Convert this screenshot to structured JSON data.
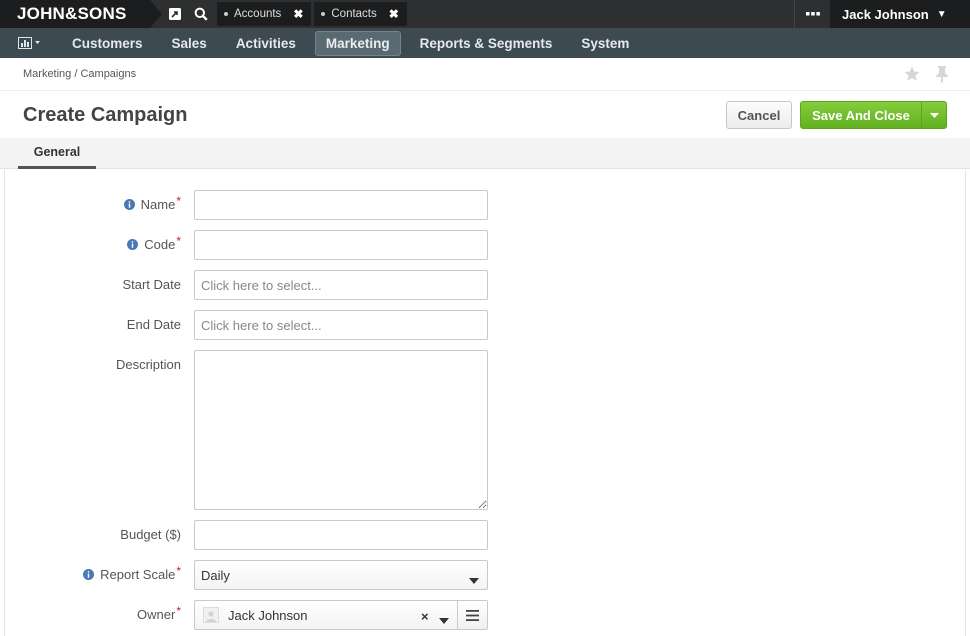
{
  "topbar": {
    "logo": "JOHN&SONS",
    "icons": [
      "external-link-icon",
      "search-icon"
    ],
    "pinned_tabs": [
      {
        "label": "Accounts"
      },
      {
        "label": "Contacts"
      }
    ],
    "more_icon": "ellipsis-icon",
    "user_name": "Jack Johnson"
  },
  "nav": {
    "dashboard_icon": "bar-chart-icon",
    "items": [
      "Customers",
      "Sales",
      "Activities",
      "Marketing",
      "Reports & Segments",
      "System"
    ],
    "active": "Marketing"
  },
  "breadcrumb": "Marketing / Campaigns",
  "page": {
    "title": "Create Campaign",
    "cancel_label": "Cancel",
    "save_label": "Save And Close"
  },
  "tabs": [
    {
      "label": "General"
    }
  ],
  "form": {
    "name": {
      "label": "Name",
      "value": ""
    },
    "code": {
      "label": "Code",
      "value": ""
    },
    "start_date": {
      "label": "Start Date",
      "placeholder": "Click here to select..."
    },
    "end_date": {
      "label": "End Date",
      "placeholder": "Click here to select..."
    },
    "description": {
      "label": "Description",
      "value": ""
    },
    "budget": {
      "label": "Budget ($)",
      "value": ""
    },
    "report_scale": {
      "label": "Report Scale",
      "value": "Daily"
    },
    "owner": {
      "label": "Owner",
      "value": "Jack Johnson"
    }
  },
  "colors": {
    "topbar": "#2e2f30",
    "navbar": "#3d4a52",
    "save_button": "#6dbb2a",
    "required": "#c81e1e",
    "info_icon": "#4a78b5"
  }
}
